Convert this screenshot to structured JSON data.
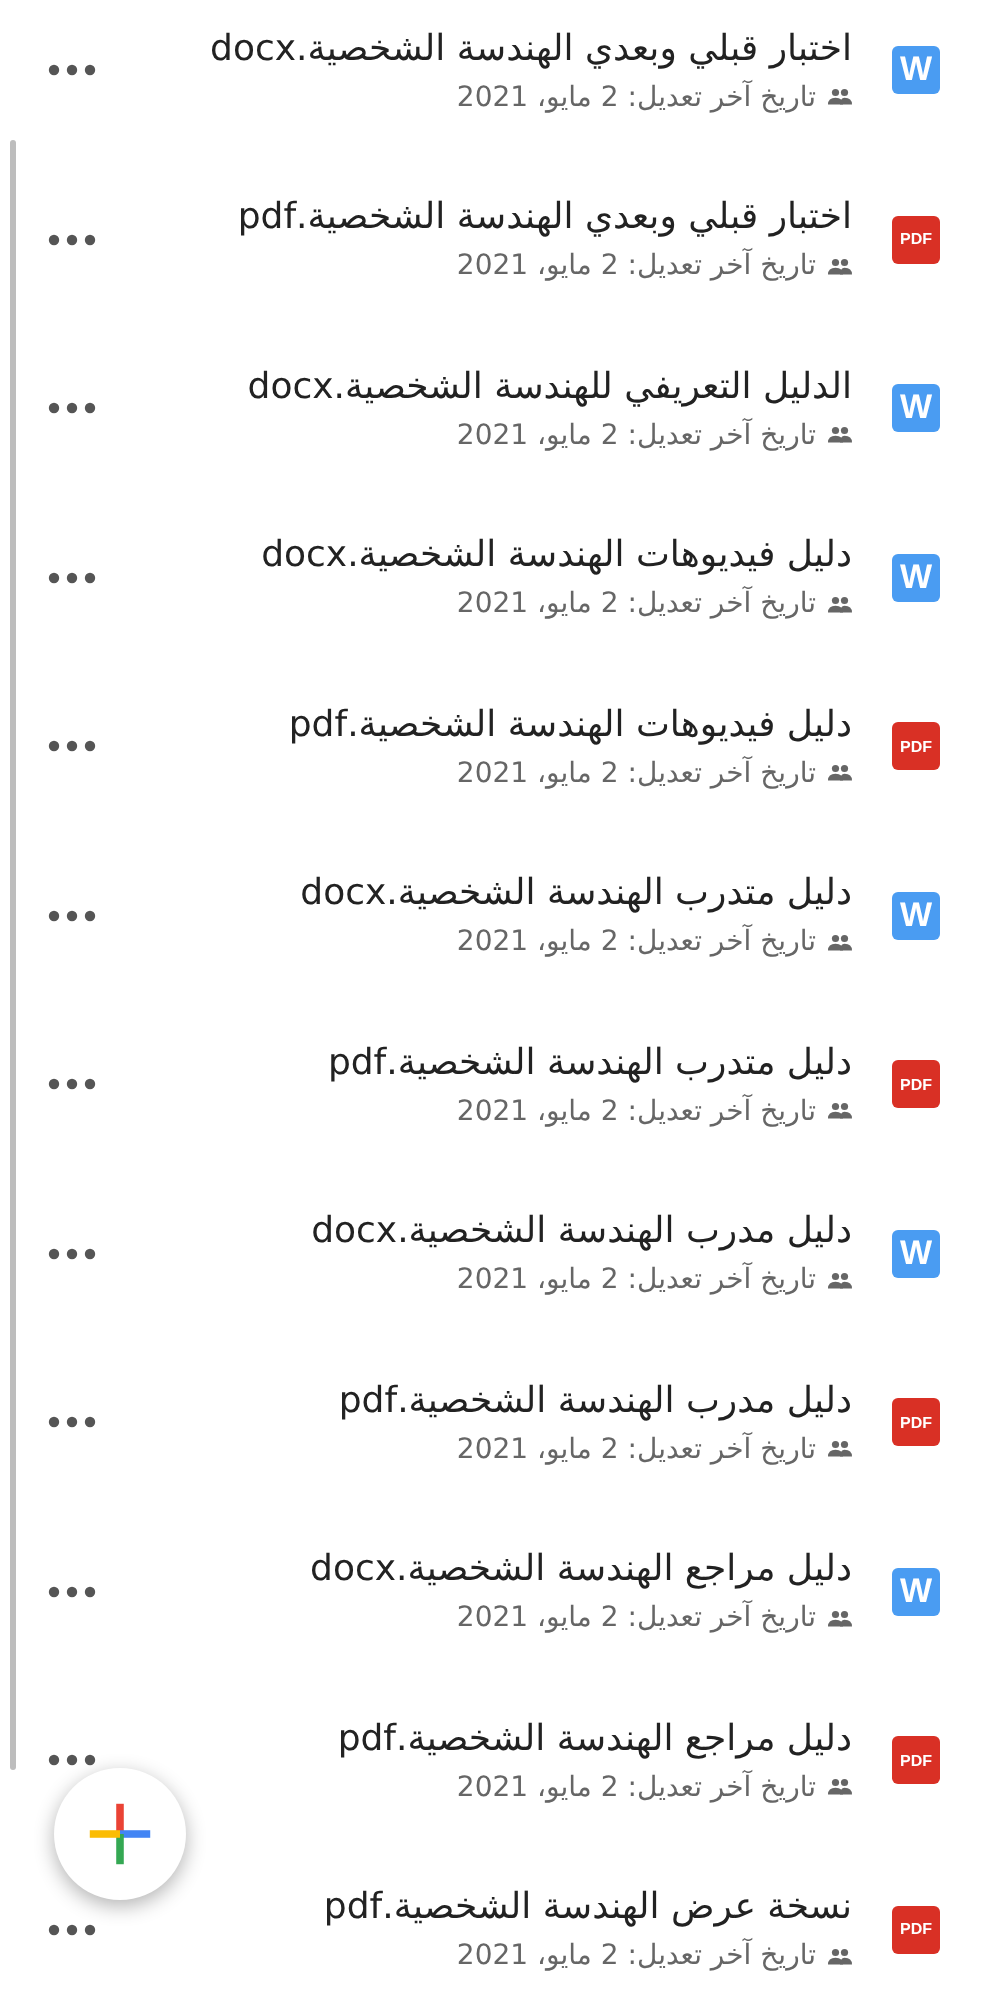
{
  "files": [
    {
      "kind": "docx",
      "icon_label": "W",
      "name": "اختبار قبلي وبعدي الهندسة الشخصية.docx",
      "modified": "تاريخ آخر تعديل: 2 مايو، 2021"
    },
    {
      "kind": "pdf",
      "icon_label": "PDF",
      "name": "اختبار قبلي وبعدي الهندسة الشخصية.pdf",
      "modified": "تاريخ آخر تعديل: 2 مايو، 2021"
    },
    {
      "kind": "docx",
      "icon_label": "W",
      "name": "الدليل التعريفي للهندسة الشخصية.docx",
      "modified": "تاريخ آخر تعديل: 2 مايو، 2021"
    },
    {
      "kind": "docx",
      "icon_label": "W",
      "name": "دليل فيديوهات الهندسة الشخصية.docx",
      "modified": "تاريخ آخر تعديل: 2 مايو، 2021"
    },
    {
      "kind": "pdf",
      "icon_label": "PDF",
      "name": "دليل فيديوهات الهندسة الشخصية.pdf",
      "modified": "تاريخ آخر تعديل: 2 مايو، 2021"
    },
    {
      "kind": "docx",
      "icon_label": "W",
      "name": "دليل متدرب الهندسة الشخصية.docx",
      "modified": "تاريخ آخر تعديل: 2 مايو، 2021"
    },
    {
      "kind": "pdf",
      "icon_label": "PDF",
      "name": "دليل متدرب الهندسة الشخصية.pdf",
      "modified": "تاريخ آخر تعديل: 2 مايو، 2021"
    },
    {
      "kind": "docx",
      "icon_label": "W",
      "name": "دليل مدرب الهندسة الشخصية.docx",
      "modified": "تاريخ آخر تعديل: 2 مايو، 2021"
    },
    {
      "kind": "pdf",
      "icon_label": "PDF",
      "name": "دليل مدرب الهندسة الشخصية.pdf",
      "modified": "تاريخ آخر تعديل: 2 مايو، 2021"
    },
    {
      "kind": "docx",
      "icon_label": "W",
      "name": "دليل مراجع الهندسة الشخصية.docx",
      "modified": "تاريخ آخر تعديل: 2 مايو، 2021"
    },
    {
      "kind": "pdf",
      "icon_label": "PDF",
      "name": "دليل مراجع الهندسة الشخصية.pdf",
      "modified": "تاريخ آخر تعديل: 2 مايو، 2021"
    },
    {
      "kind": "pdf",
      "icon_label": "PDF",
      "name": "نسخة عرض الهندسة الشخصية.pdf",
      "modified": "تاريخ آخر تعديل: 2 مايو، 2021"
    }
  ]
}
